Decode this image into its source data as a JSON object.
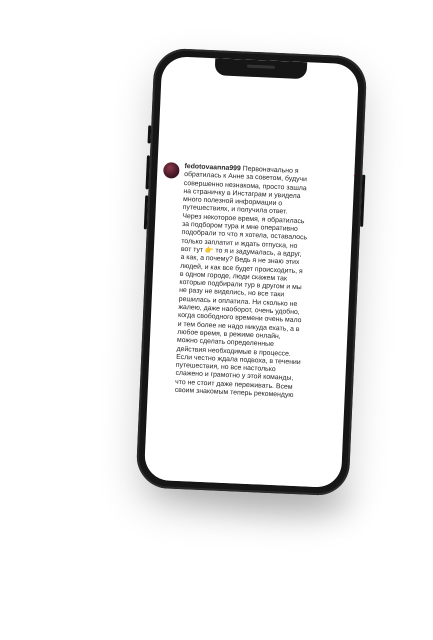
{
  "comment": {
    "username": "fedotovaanna999",
    "text": "Первоначально я\nобратилась к Анне за советом, будучи\nсовершенно незнакома, просто зашла\nна страничку в Инстаграм и увидела\nмного полезной информации о\nпутешествиях, и получила ответ.\nЧерез некоторое время, я обратилась\nза подбором тура и мне оперативно\nподобрали то что я хотела, оставалось\nтолько заплатит и ждать отпуска, но\nвот тут 👉 то я и задумалась, а вдруг,\nа как, а почему? Ведь я не знаю этих\nлюдей, и как все будет происходить, я\nв одном городе, люди скажем так\nкоторые подбирали тур в другом и мы\nне разу не виделись, но все таки\nрешилась и оплатила. Ни сколько не\nжалею, даже наоборот, очень удобно,\nкогда свободного времени очень мало\nи тем более не надо никуда ехать, а в\nлюбое время, в режиме онлайн,\nможно сделать определенные\nдействия необходимые в процессе.\nЕсли честно ждала подвоха, в течении\nпутешествия, но все настолько\nслажено и грамотно у этой команды,\nчто не стоит даже переживать. Всем\nсвоим знакомым теперь рекомендую",
    "heart_icon": "heart-icon",
    "heart_color": "#ed4956"
  }
}
